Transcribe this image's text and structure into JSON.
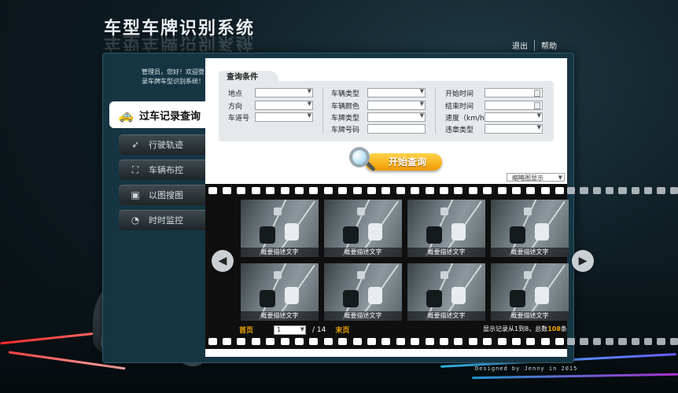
{
  "app": {
    "title": "车型车牌识别系统"
  },
  "top_links": {
    "logout": "退出",
    "help": "帮助"
  },
  "welcome": {
    "line1": "管理员，您好！欢迎登",
    "line2": "录车牌车型识别系统！"
  },
  "sidebar": {
    "items": [
      {
        "label": "过车记录查询",
        "icon": "car-records-icon",
        "active": true
      },
      {
        "label": "行驶轨迹",
        "icon": "trajectory-icon",
        "active": false
      },
      {
        "label": "车辆布控",
        "icon": "vehicle-control-icon",
        "active": false
      },
      {
        "label": "以图搜图",
        "icon": "image-search-icon",
        "active": false
      },
      {
        "label": "时时监控",
        "icon": "monitor-icon",
        "active": false
      }
    ]
  },
  "query": {
    "title": "查询条件",
    "col1": [
      "地点",
      "方向",
      "车道号"
    ],
    "col2": [
      "车辆类型",
      "车辆颜色",
      "车牌类型",
      "车牌号码"
    ],
    "col3": [
      "开始时间",
      "结束时间",
      "速度（km/h）",
      "违章类型"
    ],
    "search_label": "开始查询",
    "view_mode": "缩略图显示"
  },
  "gallery": {
    "caption": "概要描述文字",
    "thumbs": [
      "概要描述文字",
      "概要描述文字",
      "概要描述文字",
      "概要描述文字",
      "概要描述文字",
      "概要描述文字",
      "概要描述文字",
      "概要描述文字"
    ]
  },
  "pager": {
    "first": "首页",
    "current": "1",
    "total": "/ 14",
    "last": "末页",
    "records_prefix": "显示记录从1到8，总数",
    "records_total": "108",
    "records_suffix": "条"
  },
  "footer": {
    "credit": "Designed by Jenny in 2015"
  }
}
